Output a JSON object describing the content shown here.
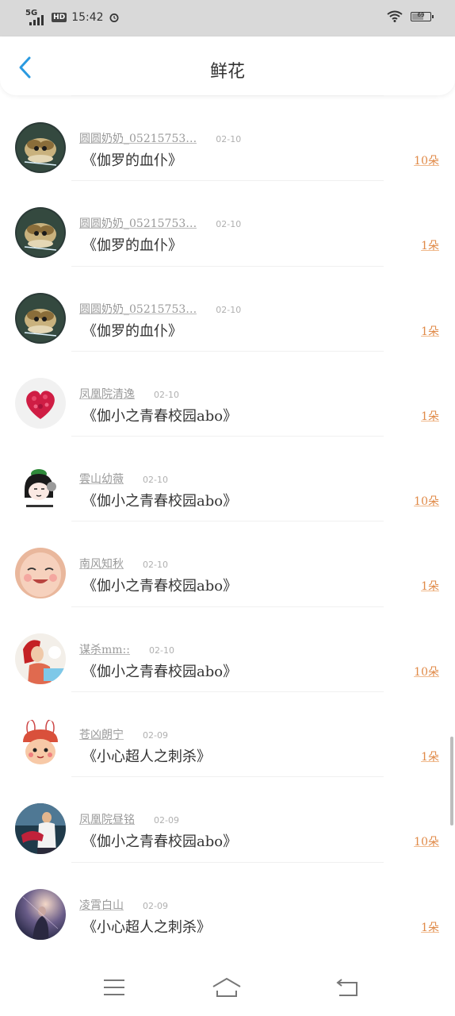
{
  "status_bar": {
    "network": "5G",
    "hd": "HD",
    "time": "15:42",
    "battery": "69",
    "battery_level": 0.69
  },
  "header": {
    "title": "鲜花",
    "back_icon": "chevron-left-icon",
    "accent_color": "#2a9ae0"
  },
  "list": [
    {
      "user": "圆圆奶奶_05215753…",
      "date": "02-10",
      "book": "《伽罗的血仆》",
      "count": "10朵",
      "avatar": "anime"
    },
    {
      "user": "圆圆奶奶_05215753…",
      "date": "02-10",
      "book": "《伽罗的血仆》",
      "count": "1朵",
      "avatar": "anime"
    },
    {
      "user": "圆圆奶奶_05215753…",
      "date": "02-10",
      "book": "《伽罗的血仆》",
      "count": "1朵",
      "avatar": "anime"
    },
    {
      "user": "凤凰院清逸",
      "date": "02-10",
      "book": "《伽小之青春校园abo》",
      "count": "1朵",
      "avatar": "heart"
    },
    {
      "user": "雲山幼薇",
      "date": "02-10",
      "book": "《伽小之青春校园abo》",
      "count": "10朵",
      "avatar": "meme"
    },
    {
      "user": "南风知秋",
      "date": "02-10",
      "book": "《伽小之青春校园abo》",
      "count": "1朵",
      "avatar": "baby"
    },
    {
      "user": "谋杀mm::",
      "date": "02-10",
      "book": "《伽小之青春校园abo》",
      "count": "10朵",
      "avatar": "woman"
    },
    {
      "user": "苍凶朗宁",
      "date": "02-09",
      "book": "《小心超人之刺杀》",
      "count": "1朵",
      "avatar": "bunny"
    },
    {
      "user": "凤凰院昼铭",
      "date": "02-09",
      "book": "《伽小之青春校园abo》",
      "count": "10朵",
      "avatar": "man"
    },
    {
      "user": "凌霄白山",
      "date": "02-09",
      "book": "《小心超人之刺杀》",
      "count": "1朵",
      "avatar": "night"
    }
  ],
  "bottom_nav": {
    "menu_icon": "menu-icon",
    "home_icon": "home-icon",
    "back_icon": "back-arrow-icon"
  }
}
